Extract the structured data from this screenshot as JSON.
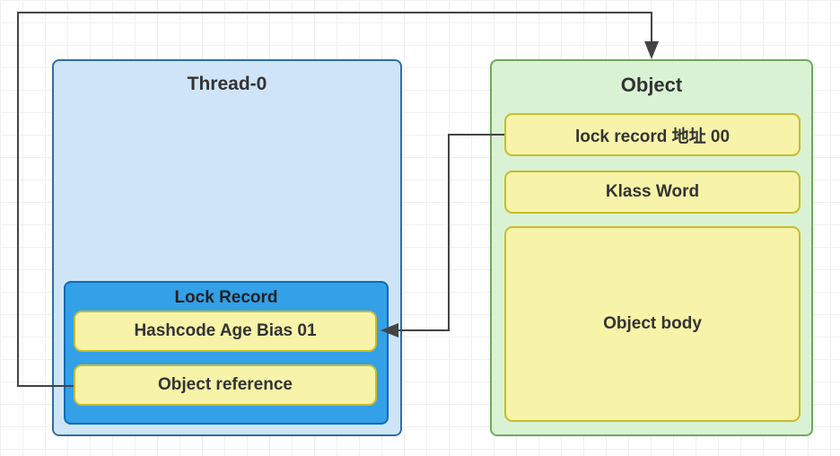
{
  "thread": {
    "title": "Thread-0",
    "lock_record": {
      "title": "Lock Record",
      "hashcode_label": "Hashcode Age Bias 01",
      "object_ref_label": "Object reference"
    }
  },
  "object": {
    "title": "Object",
    "lock_addr_label": "lock record 地址 00",
    "klass_label": "Klass Word",
    "body_label": "Object body"
  }
}
